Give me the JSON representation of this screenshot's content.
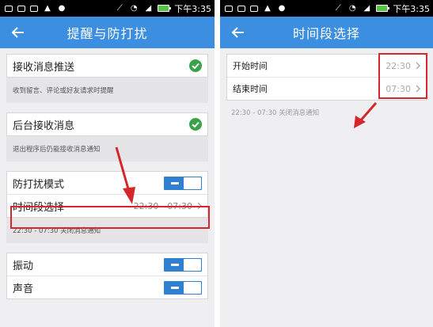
{
  "status_bar": {
    "time": "下午3:35"
  },
  "left": {
    "title": "提醒与防打扰",
    "rows": {
      "push": {
        "label": "接收消息推送",
        "hint": "收到留言、评论或好友请求时提醒"
      },
      "background": {
        "label": "后台接收消息",
        "hint": "退出程序后仍能接收消息通知"
      },
      "dnd": {
        "label": "防打扰模式"
      },
      "period": {
        "label": "时间段选择",
        "value": "22:30 - 07:30",
        "hint": "22:30 - 07:30 关闭消息通知"
      },
      "vibrate": {
        "label": "振动"
      },
      "sound": {
        "label": "声音"
      }
    }
  },
  "right": {
    "title": "时间段选择",
    "start": {
      "label": "开始时间",
      "value": "22:30"
    },
    "end": {
      "label": "结束时间",
      "value": "07:30"
    },
    "hint": "22:30 - 07:30 关闭消息通知"
  },
  "colors": {
    "accent": "#3c8fe0",
    "toggle_on": "#2f7fd2",
    "check_green": "#3aa34a",
    "annotation_red": "#d5262b"
  }
}
